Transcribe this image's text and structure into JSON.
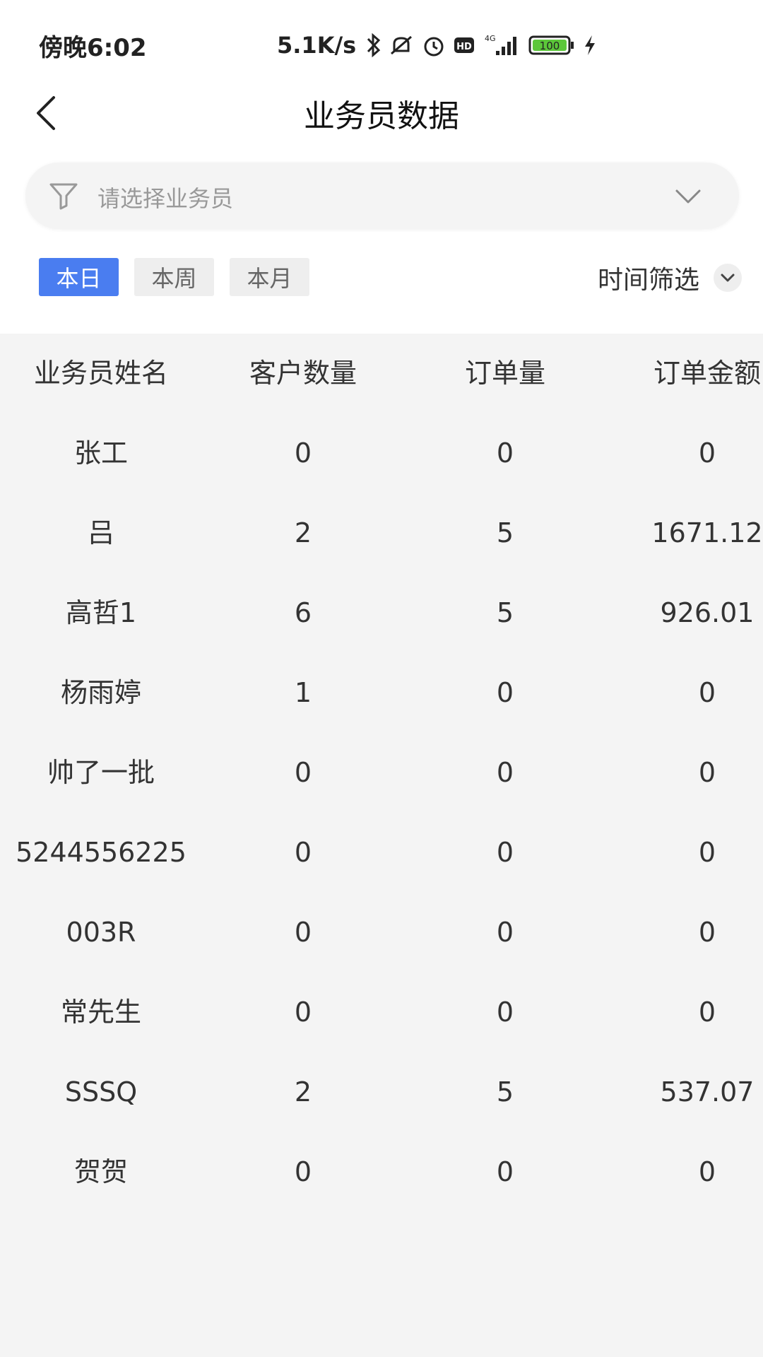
{
  "status_bar": {
    "time": "傍晚6:02",
    "net_speed": "5.1K/s",
    "network": "4G",
    "hd": "HD",
    "battery": "100"
  },
  "header": {
    "title": "业务员数据"
  },
  "selector": {
    "placeholder": "请选择业务员"
  },
  "tabs": [
    {
      "label": "本日",
      "active": true
    },
    {
      "label": "本周",
      "active": false
    },
    {
      "label": "本月",
      "active": false
    }
  ],
  "time_filter": {
    "label": "时间筛选"
  },
  "table": {
    "columns": [
      "业务员姓名",
      "客户数量",
      "订单量",
      "订单金额"
    ],
    "rows": [
      [
        "张工",
        "0",
        "0",
        "0"
      ],
      [
        "吕",
        "2",
        "5",
        "1671.12"
      ],
      [
        "高哲1",
        "6",
        "5",
        "926.01"
      ],
      [
        "杨雨婷",
        "1",
        "0",
        "0"
      ],
      [
        "帅了一批",
        "0",
        "0",
        "0"
      ],
      [
        "5244556225",
        "0",
        "0",
        "0"
      ],
      [
        "003R",
        "0",
        "0",
        "0"
      ],
      [
        "常先生",
        "0",
        "0",
        "0"
      ],
      [
        "SSSQ",
        "2",
        "5",
        "537.07"
      ],
      [
        "贺贺",
        "0",
        "0",
        "0"
      ]
    ]
  },
  "colors": {
    "accent": "#4a7df0",
    "table_bg": "#f4f4f4"
  }
}
